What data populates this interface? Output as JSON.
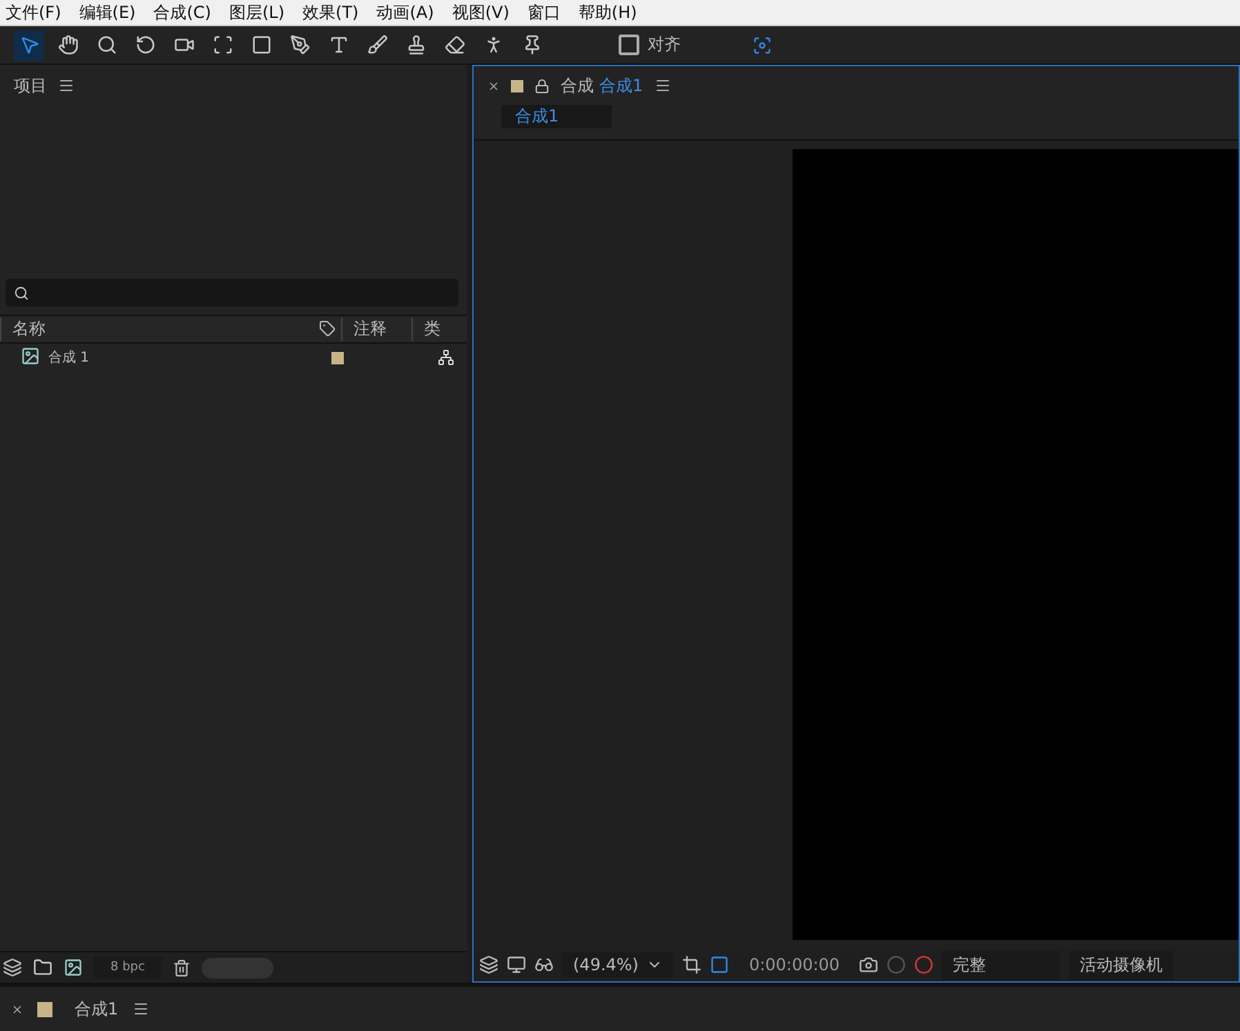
{
  "menu": [
    "文件(F)",
    "编辑(E)",
    "合成(C)",
    "图层(L)",
    "效果(T)",
    "动画(A)",
    "视图(V)",
    "窗口",
    "帮助(H)"
  ],
  "tools": [
    {
      "kind": "select",
      "selected": true
    },
    {
      "kind": "hand",
      "selected": false
    },
    {
      "kind": "zoom",
      "selected": false
    },
    {
      "kind": "rotate",
      "selected": false
    },
    {
      "kind": "camera",
      "selected": false
    },
    {
      "kind": "pan",
      "selected": false
    },
    {
      "kind": "rect",
      "selected": false
    },
    {
      "kind": "pen",
      "selected": false
    },
    {
      "kind": "text",
      "selected": false
    },
    {
      "kind": "brush",
      "selected": false
    },
    {
      "kind": "stamp",
      "selected": false
    },
    {
      "kind": "eraser",
      "selected": false
    },
    {
      "kind": "roto",
      "selected": false
    },
    {
      "kind": "pin",
      "selected": false
    }
  ],
  "snap": {
    "label": "对齐",
    "checked": false
  },
  "project": {
    "title": "项目",
    "columns": [
      "名称",
      "注释",
      "类"
    ],
    "items": [
      {
        "name": "合成 1",
        "color": "#c8b48a"
      }
    ],
    "bpc": "8 bpc"
  },
  "composition": {
    "prefix": "合成",
    "name": "合成1",
    "color": "#c8b48a",
    "breadcrumb": "合成1",
    "zoom": "(49.4%)",
    "timecode": "0:00:00:00",
    "resolution": "完整",
    "camera": "活动摄像机"
  },
  "timeline": {
    "name": "合成1",
    "color": "#c8b48a"
  }
}
